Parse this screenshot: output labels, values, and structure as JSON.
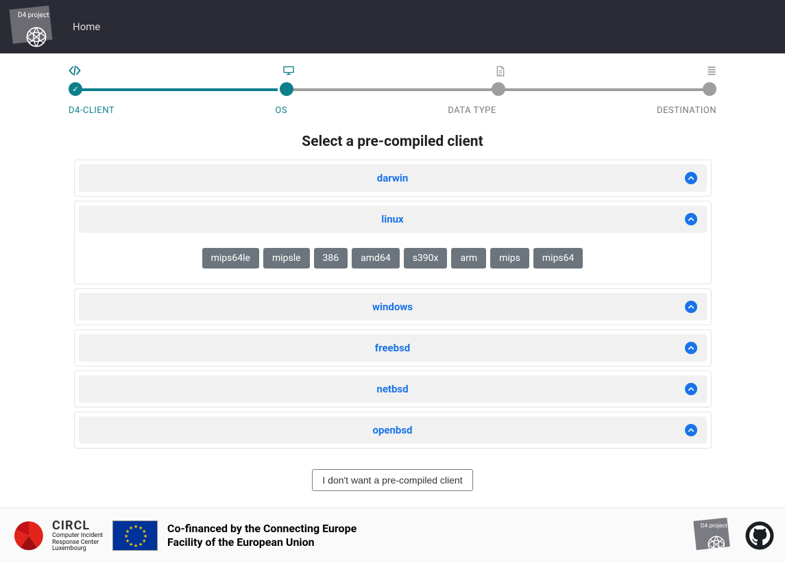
{
  "nav": {
    "brand": "D4 project",
    "home": "Home"
  },
  "stepper": {
    "steps": [
      {
        "label": "D4-CLIENT",
        "state": "done",
        "icon": "code"
      },
      {
        "label": "OS",
        "state": "active",
        "icon": "desktop"
      },
      {
        "label": "DATA TYPE",
        "state": "todo",
        "icon": "file"
      },
      {
        "label": "DESTINATION",
        "state": "todo",
        "icon": "list"
      }
    ]
  },
  "main": {
    "title": "Select a pre-compiled client",
    "os": [
      {
        "name": "darwin",
        "expanded": false
      },
      {
        "name": "linux",
        "expanded": true,
        "arch": [
          "mips64le",
          "mipsle",
          "386",
          "amd64",
          "s390x",
          "arm",
          "mips",
          "mips64"
        ]
      },
      {
        "name": "windows",
        "expanded": false
      },
      {
        "name": "freebsd",
        "expanded": false
      },
      {
        "name": "netbsd",
        "expanded": false
      },
      {
        "name": "openbsd",
        "expanded": false
      }
    ],
    "skip_label": "I don't want a pre-compiled client"
  },
  "footer": {
    "circl_name": "CIRCL",
    "circl_sub1": "Computer Incident",
    "circl_sub2": "Response Center",
    "circl_sub3": "Luxembourg",
    "cef_line1": "Co-financed by the Connecting Europe",
    "cef_line2": "Facility of the European Union",
    "brand": "D4 project"
  }
}
